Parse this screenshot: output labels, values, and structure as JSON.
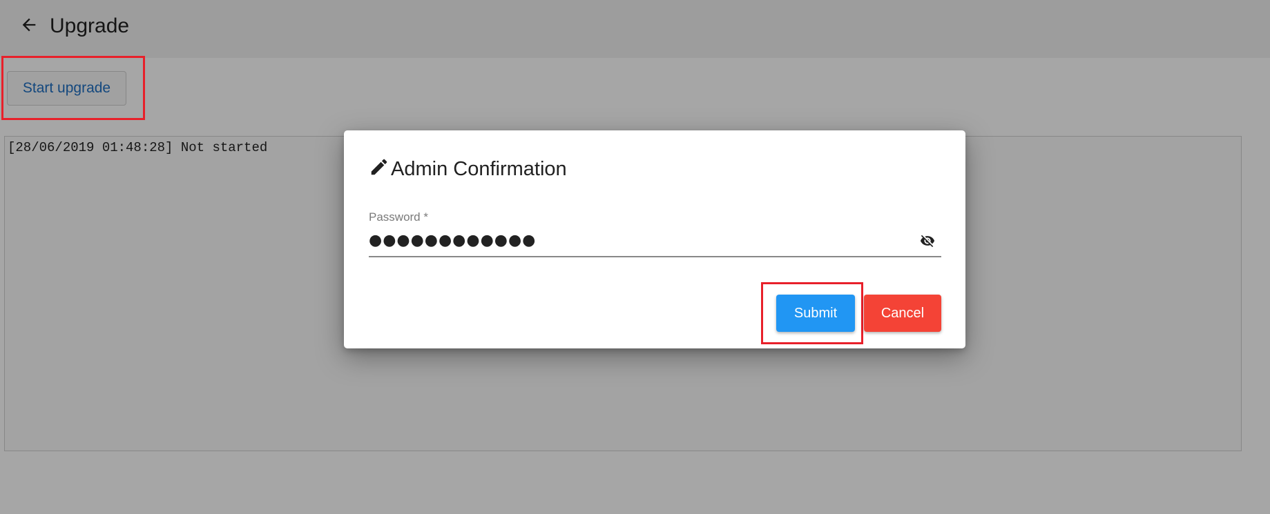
{
  "header": {
    "title": "Upgrade",
    "back_icon": "arrow-left-icon"
  },
  "toolbar": {
    "start_upgrade_label": "Start upgrade"
  },
  "log": {
    "text": "[28/06/2019 01:48:28] Not started"
  },
  "dialog": {
    "title": "Admin Confirmation",
    "title_icon": "pencil-icon",
    "password": {
      "label": "Password *",
      "value": "●●●●●●●●●●●●",
      "toggle_icon": "eye-off-icon"
    },
    "submit_label": "Submit",
    "cancel_label": "Cancel"
  },
  "colors": {
    "primary": "#2196f3",
    "danger": "#f44336",
    "link": "#1f6fc2",
    "highlight": "#e8202a"
  }
}
